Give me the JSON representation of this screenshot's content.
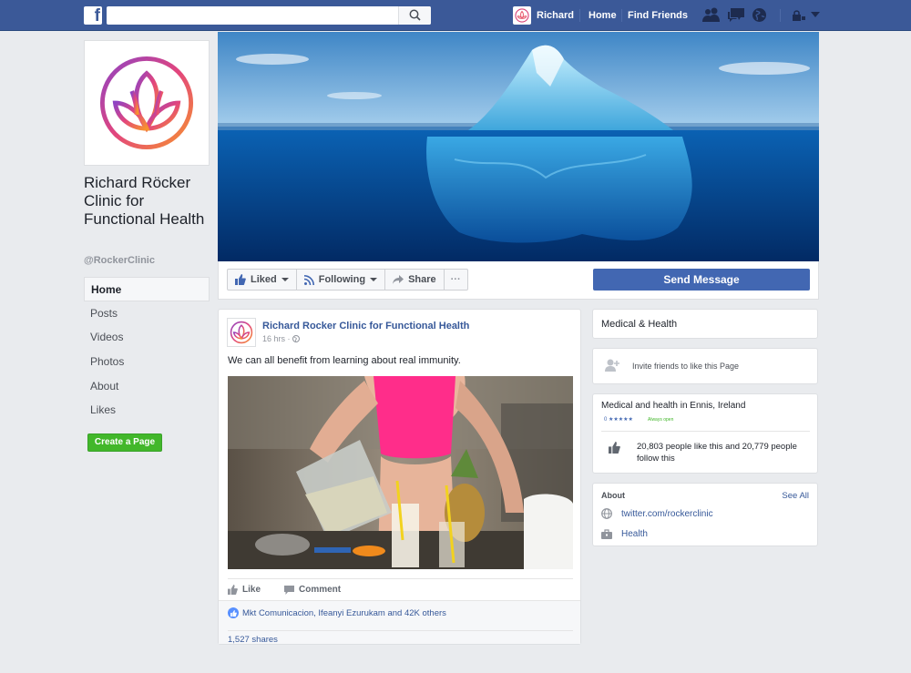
{
  "topbar": {
    "logo": "f",
    "user_name": "Richard",
    "home": "Home",
    "find_friends": "Find Friends",
    "icons": [
      "friend-requests-icon",
      "messages-icon",
      "notifications-globe-icon",
      "privacy-lock-icon",
      "account-menu-caret-icon"
    ]
  },
  "page": {
    "name": "Richard Röcker Clinic for Functional Health",
    "handle": "@RockerClinic",
    "nav": [
      "Home",
      "Posts",
      "Videos",
      "Photos",
      "About",
      "Likes"
    ],
    "create_page": "Create a Page"
  },
  "actions": {
    "liked": "Liked",
    "following": "Following",
    "share": "Share",
    "more": "···",
    "send_message": "Send Message"
  },
  "post": {
    "author": "Richard Rocker Clinic for Functional Health",
    "time": "16 hrs · ",
    "text": "We can all benefit from learning about real immunity.",
    "like": "Like",
    "comment": "Comment",
    "likers": "Mkt Comunicacion, Ifeanyi Ezurukam and 42K others",
    "shares": "1,527 shares"
  },
  "sidebar": {
    "category": "Medical & Health",
    "invite": "Invite friends to like this Page",
    "info_title": "Medical and health in Ennis, Ireland",
    "rating": "0 ★★★★★",
    "hours": "Always open",
    "likes_text": "20,803 people like this and 20,779 people follow this",
    "about_title": "About",
    "see_all": "See All",
    "website": "twitter.com/rockerclinic",
    "category_link": "Health"
  },
  "colors": {
    "brand_blue": "#3b5998",
    "button_blue": "#4267b2",
    "green": "#42b72a",
    "link": "#365899"
  }
}
